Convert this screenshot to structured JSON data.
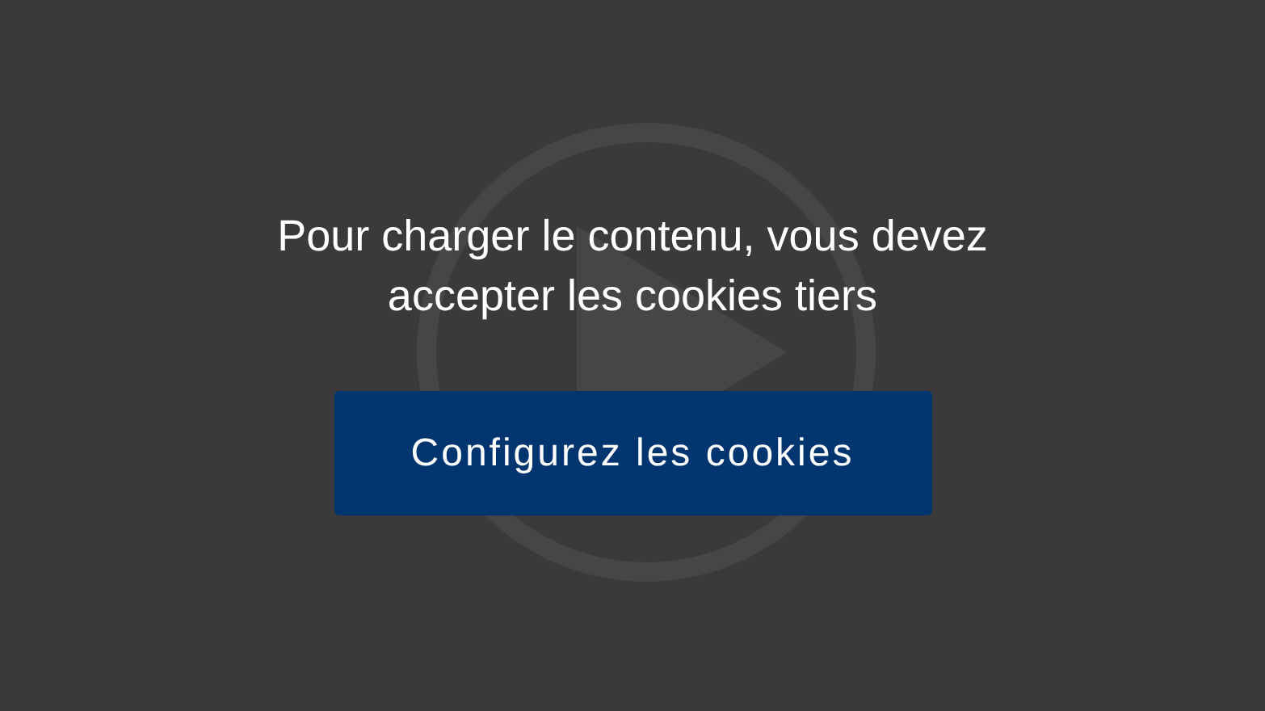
{
  "message": "Pour charger le contenu, vous devez accepter les cookies tiers",
  "button": {
    "label": "Configurez les cookies"
  }
}
